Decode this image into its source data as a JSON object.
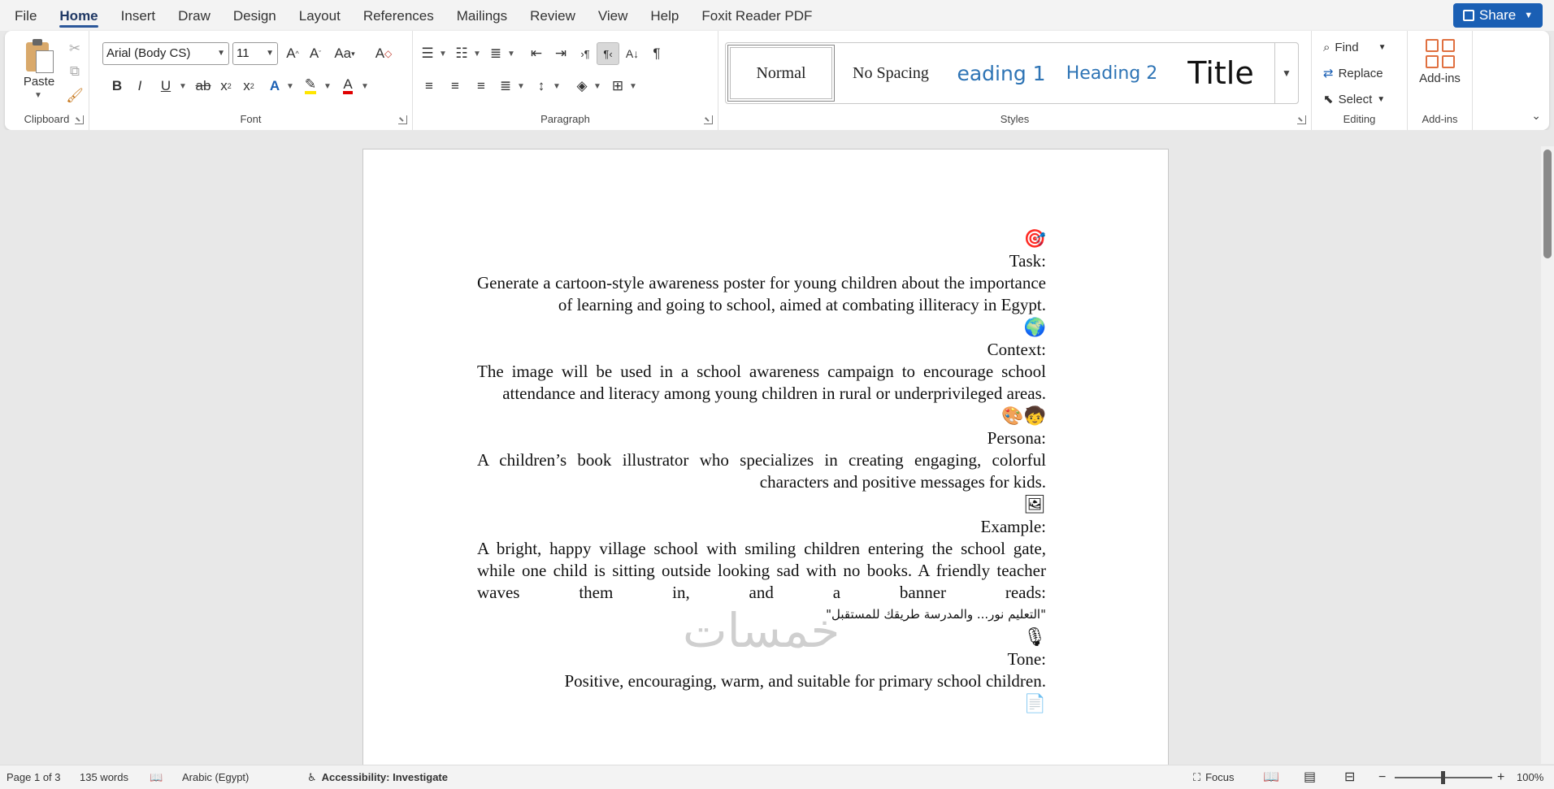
{
  "menu": {
    "tabs": [
      "File",
      "Home",
      "Insert",
      "Draw",
      "Design",
      "Layout",
      "References",
      "Mailings",
      "Review",
      "View",
      "Help",
      "Foxit Reader PDF"
    ],
    "active_tab": "Home",
    "share_label": "Share"
  },
  "ribbon": {
    "clipboard": {
      "label": "Clipboard",
      "paste_label": "Paste"
    },
    "font": {
      "label": "Font",
      "font_name": "Arial (Body CS)",
      "font_size": "11"
    },
    "paragraph": {
      "label": "Paragraph"
    },
    "styles": {
      "label": "Styles",
      "items": [
        "Normal",
        "No Spacing",
        "eading 1",
        "Heading 2",
        "Title"
      ],
      "selected": "Normal"
    },
    "editing": {
      "label": "Editing",
      "find": "Find",
      "replace": "Replace",
      "select": "Select"
    },
    "addins": {
      "label": "Add-ins",
      "button": "Add-ins"
    }
  },
  "document": {
    "emoji_task": "🎯",
    "task_heading": "Task:",
    "task_body": "Generate a cartoon-style awareness poster for young children about the importance of learning and going to school, aimed at combating illiteracy in Egypt.",
    "emoji_context": "🌍",
    "context_heading": "Context:",
    "context_body": "The image will be used in a school awareness campaign to encourage school attendance and literacy among young children in rural or underprivileged areas.",
    "emoji_persona": "🧒🎨",
    "persona_heading": "Persona:",
    "persona_body": "A children’s book illustrator who specializes in creating engaging, colorful characters and positive messages for kids.",
    "emoji_example": "🖼",
    "example_heading": "Example:",
    "example_body_1": "A bright, happy village school with smiling children entering the school gate, while one child is sitting outside looking sad with no books. A friendly teacher waves them in, and a banner reads:",
    "example_quote": "\"التعليم نور... والمدرسة طريقك للمستقبل\"",
    "emoji_tone": "🎙",
    "tone_heading": "Tone:",
    "tone_body": "Positive, encouraging, warm, and suitable for primary school children.",
    "emoji_format": "📄",
    "watermark": "خمسات"
  },
  "status": {
    "page": "Page 1 of 3",
    "words": "135 words",
    "language": "Arabic (Egypt)",
    "accessibility": "Accessibility: Investigate",
    "focus": "Focus",
    "zoom": "100%"
  }
}
